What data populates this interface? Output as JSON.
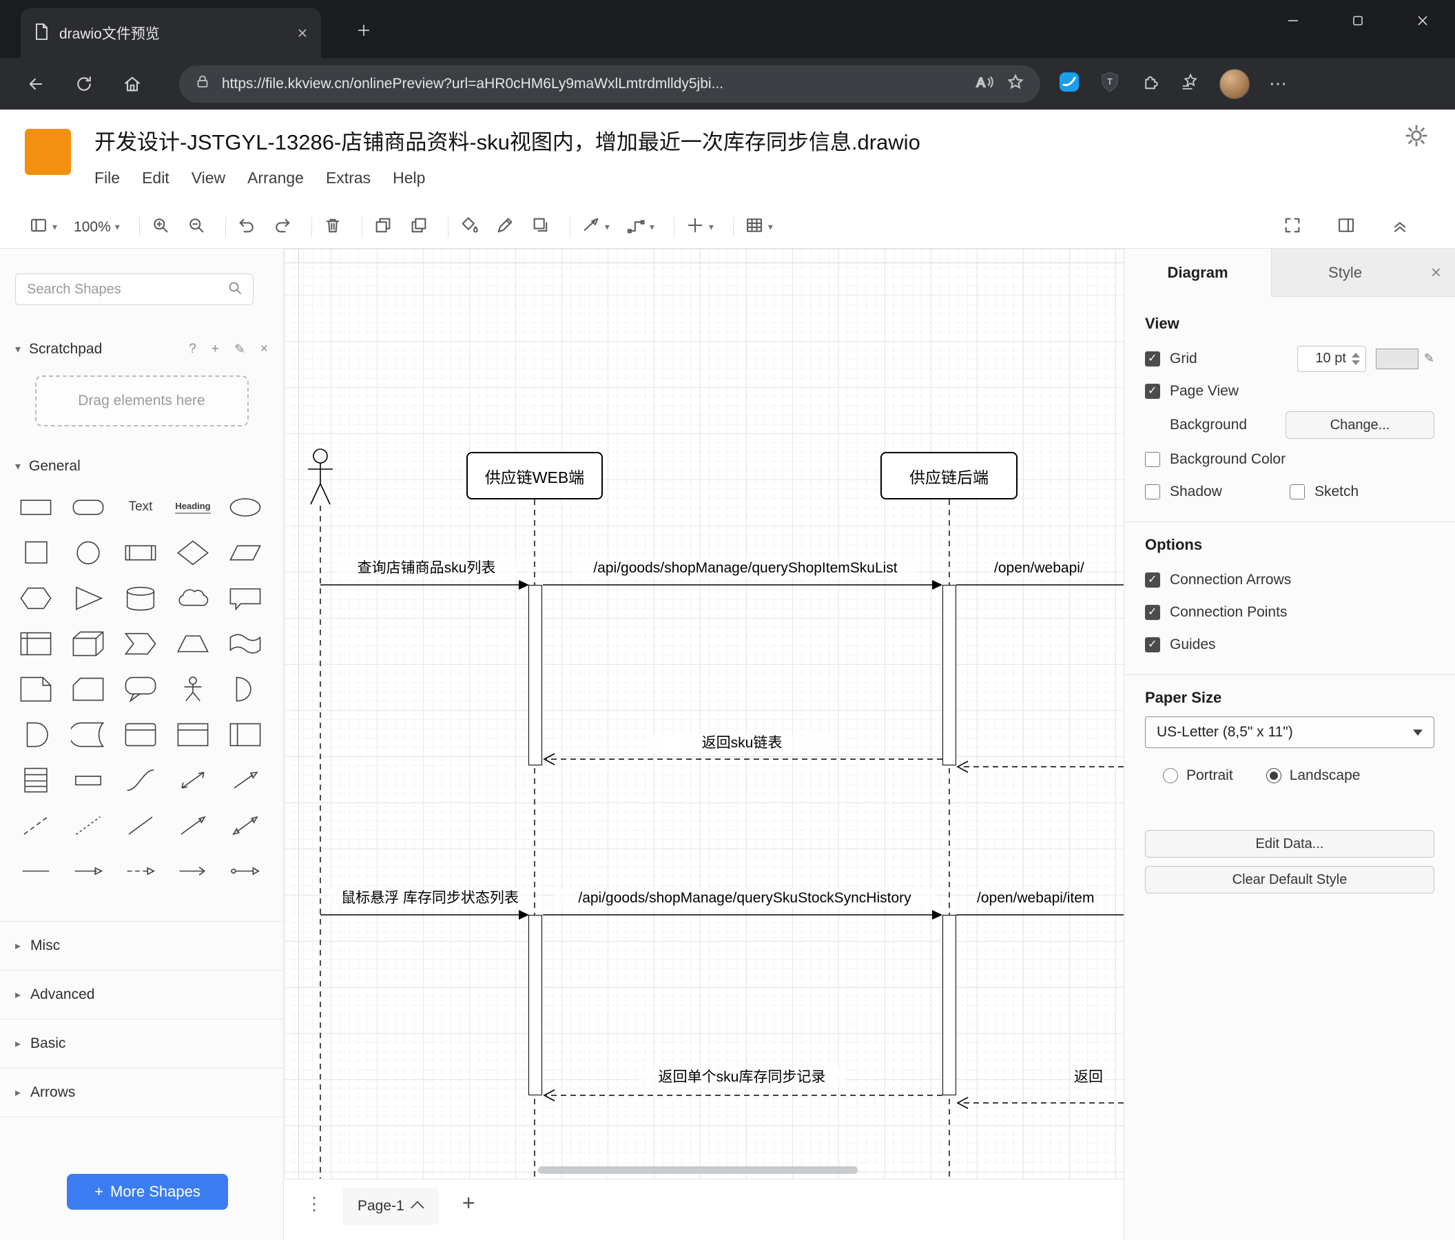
{
  "colors": {
    "accent_blue": "#3b7df0",
    "logo_orange": "#f29111",
    "chrome_dark": "#1b1c1f"
  },
  "browser": {
    "tab_title": "drawio文件预览",
    "url": "https://file.kkview.cn/onlinePreview?url=aHR0cHM6Ly9maWxlLmtrdmlldy5jbi..."
  },
  "app": {
    "title": "开发设计-JSTGYL-13286-店铺商品资料-sku视图内，增加最近一次库存同步信息.drawio",
    "menus": [
      "File",
      "Edit",
      "View",
      "Arrange",
      "Extras",
      "Help"
    ],
    "zoom_level": "100%"
  },
  "sidebar": {
    "search_placeholder": "Search Shapes",
    "scratchpad_label": "Scratchpad",
    "scratchpad_hint": "Drag elements here",
    "general_label": "General",
    "labels": {
      "text": "Text",
      "heading": "Heading"
    },
    "shapes": [
      "rectangle",
      "rounded-rectangle",
      "text",
      "heading",
      "ellipse",
      "square",
      "circle",
      "process",
      "diamond",
      "parallelogram",
      "hexagon",
      "triangle",
      "cylinder",
      "cloud",
      "callout-rectangle",
      "internal-storage",
      "cube",
      "step",
      "trapezoid",
      "tape",
      "note",
      "card",
      "callout",
      "actor",
      "or",
      "and",
      "data-storage",
      "container",
      "titled-container",
      "vertical-container",
      "list",
      "list-item",
      "curve",
      "bidirectional-arrow",
      "arrow",
      "dashed-line",
      "dotted-line",
      "line",
      "directional-line",
      "bidirectional-line",
      "link",
      "arrow-right",
      "dashed-arrow",
      "open-arrow",
      "connector-arrow"
    ],
    "collapsed_sections": [
      "Misc",
      "Advanced",
      "Basic",
      "Arrows"
    ],
    "more_shapes_label": "More Shapes"
  },
  "canvas": {
    "lifelines": [
      {
        "label": "供应链WEB端"
      },
      {
        "label": "供应链后端"
      }
    ],
    "messages": {
      "m1": "查询店铺商品sku列表",
      "m2": "/api/goods/shopManage/queryShopItemSkuList",
      "m3": "/open/webapi/",
      "r1": "返回sku链表",
      "m4": "鼠标悬浮 库存同步状态列表",
      "m5": "/api/goods/shopManage/querySkuStockSyncHistory",
      "m6": "/open/webapi/item",
      "r2": "返回单个sku库存同步记录",
      "r3": "返回"
    }
  },
  "page_bar": {
    "page": "Page-1"
  },
  "format": {
    "tabs": [
      "Diagram",
      "Style"
    ],
    "view": {
      "heading": "View",
      "grid": {
        "label": "Grid",
        "value": "10 pt",
        "checked": true
      },
      "page_view": {
        "label": "Page View",
        "checked": true
      },
      "background_label": "Background",
      "change_button": "Change...",
      "background_color": {
        "label": "Background Color",
        "checked": false
      },
      "shadow": {
        "label": "Shadow",
        "checked": false
      },
      "sketch": {
        "label": "Sketch",
        "checked": false
      }
    },
    "options": {
      "heading": "Options",
      "connection_arrows": {
        "label": "Connection Arrows",
        "checked": true
      },
      "connection_points": {
        "label": "Connection Points",
        "checked": true
      },
      "guides": {
        "label": "Guides",
        "checked": true
      }
    },
    "paper": {
      "heading": "Paper Size",
      "size": "US-Letter (8,5\" x 11\")",
      "portrait": {
        "label": "Portrait",
        "selected": false
      },
      "landscape": {
        "label": "Landscape",
        "selected": true
      }
    },
    "buttons": {
      "edit_data": "Edit Data...",
      "clear_default_style": "Clear Default Style"
    }
  }
}
